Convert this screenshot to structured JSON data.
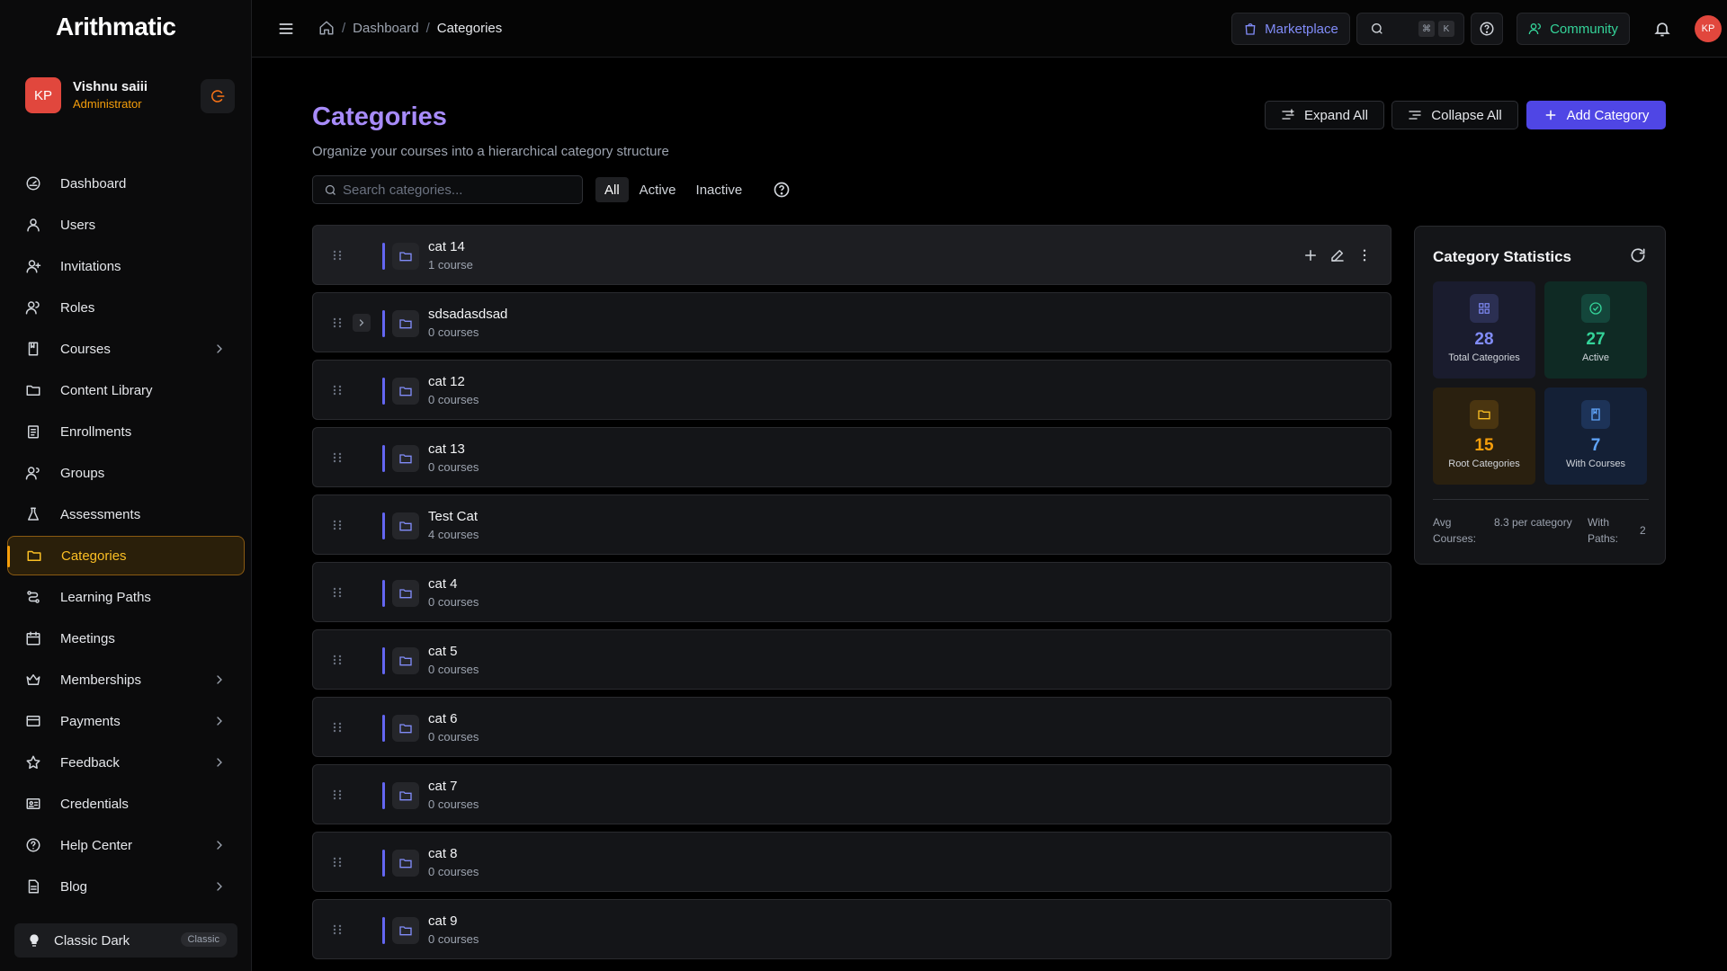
{
  "app": {
    "logo_text": "Arithmatic"
  },
  "user": {
    "initials": "KP",
    "name": "Vishnu saiii",
    "role": "Administrator"
  },
  "sidebar": {
    "items": [
      {
        "label": "Dashboard",
        "icon": "dashboard-icon",
        "has_children": false,
        "active": false
      },
      {
        "label": "Users",
        "icon": "user-icon",
        "has_children": false,
        "active": false
      },
      {
        "label": "Invitations",
        "icon": "user-plus-icon",
        "has_children": false,
        "active": false
      },
      {
        "label": "Roles",
        "icon": "users-icon",
        "has_children": false,
        "active": false
      },
      {
        "label": "Courses",
        "icon": "book-icon",
        "has_children": true,
        "active": false
      },
      {
        "label": "Content Library",
        "icon": "folder-icon",
        "has_children": false,
        "active": false
      },
      {
        "label": "Enrollments",
        "icon": "clipboard-icon",
        "has_children": false,
        "active": false
      },
      {
        "label": "Groups",
        "icon": "group-icon",
        "has_children": false,
        "active": false
      },
      {
        "label": "Assessments",
        "icon": "flask-icon",
        "has_children": false,
        "active": false
      },
      {
        "label": "Categories",
        "icon": "folder-icon",
        "has_children": false,
        "active": true
      },
      {
        "label": "Learning Paths",
        "icon": "route-icon",
        "has_children": false,
        "active": false
      },
      {
        "label": "Meetings",
        "icon": "calendar-icon",
        "has_children": false,
        "active": false
      },
      {
        "label": "Memberships",
        "icon": "crown-icon",
        "has_children": true,
        "active": false
      },
      {
        "label": "Payments",
        "icon": "credit-card-icon",
        "has_children": true,
        "active": false
      },
      {
        "label": "Feedback",
        "icon": "star-icon",
        "has_children": true,
        "active": false
      },
      {
        "label": "Credentials",
        "icon": "id-card-icon",
        "has_children": false,
        "active": false
      },
      {
        "label": "Help Center",
        "icon": "help-circle-icon",
        "has_children": true,
        "active": false
      },
      {
        "label": "Blog",
        "icon": "file-text-icon",
        "has_children": true,
        "active": false
      }
    ],
    "theme": {
      "label": "Classic Dark",
      "badge": "Classic"
    }
  },
  "topbar": {
    "breadcrumb": [
      "Dashboard",
      "Categories"
    ],
    "marketplace_label": "Marketplace",
    "search_shortcut": [
      "⌘",
      "K"
    ],
    "community_label": "Community",
    "avatar_initials": "KP"
  },
  "page": {
    "title": "Categories",
    "subtitle": "Organize your courses into a hierarchical category structure",
    "expand_all": "Expand All",
    "collapse_all": "Collapse All",
    "add_category": "Add Category",
    "search_placeholder": "Search categories...",
    "filters": [
      "All",
      "Active",
      "Inactive"
    ],
    "active_filter": "All"
  },
  "categories": [
    {
      "name": "cat 14",
      "count": "1 course",
      "expandable": false,
      "hovered": true
    },
    {
      "name": "sdsadasdsad",
      "count": "0 courses",
      "expandable": true,
      "hovered": false
    },
    {
      "name": "cat 12",
      "count": "0 courses",
      "expandable": false,
      "hovered": false
    },
    {
      "name": "cat 13",
      "count": "0 courses",
      "expandable": false,
      "hovered": false
    },
    {
      "name": "Test Cat",
      "count": "4 courses",
      "expandable": false,
      "hovered": false
    },
    {
      "name": "cat 4",
      "count": "0 courses",
      "expandable": false,
      "hovered": false
    },
    {
      "name": "cat 5",
      "count": "0 courses",
      "expandable": false,
      "hovered": false
    },
    {
      "name": "cat 6",
      "count": "0 courses",
      "expandable": false,
      "hovered": false
    },
    {
      "name": "cat 7",
      "count": "0 courses",
      "expandable": false,
      "hovered": false
    },
    {
      "name": "cat 8",
      "count": "0 courses",
      "expandable": false,
      "hovered": false
    },
    {
      "name": "cat 9",
      "count": "0 courses",
      "expandable": false,
      "hovered": false
    }
  ],
  "stats": {
    "title": "Category Statistics",
    "total": {
      "value": "28",
      "label": "Total Categories"
    },
    "active": {
      "value": "27",
      "label": "Active"
    },
    "root": {
      "value": "15",
      "label": "Root Categories"
    },
    "with_courses": {
      "value": "7",
      "label": "With Courses"
    },
    "avg_label": "Avg Courses:",
    "avg_value": "8.3 per category",
    "paths_label": "With Paths:",
    "paths_value": "2"
  },
  "colors": {
    "accent": "#4f46e5",
    "active_nav": "#f59e0b",
    "title": "#a78bfa"
  }
}
